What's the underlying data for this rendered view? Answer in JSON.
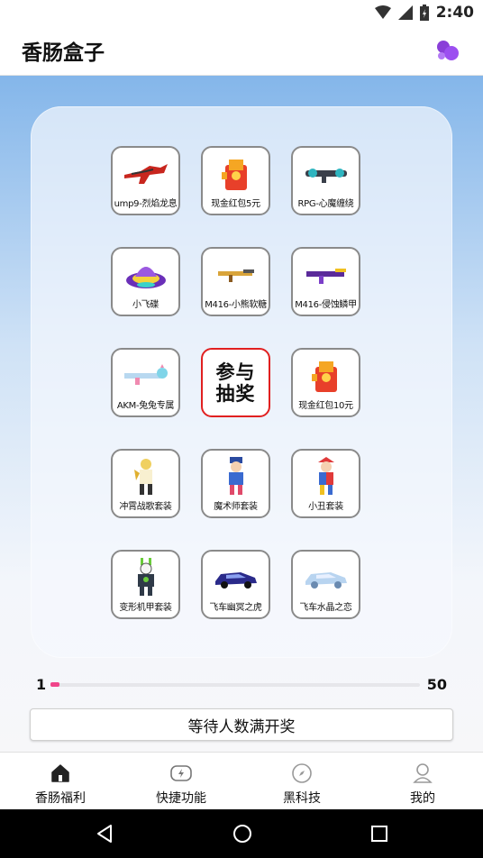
{
  "status": {
    "time": "2:40"
  },
  "app": {
    "title": "香肠盒子",
    "logo_icon": "purple-bubbles-icon"
  },
  "grid": {
    "items": [
      {
        "label": "ump9-烈焰龙息",
        "icon": "red-dragon-gun-icon"
      },
      {
        "label": "现金红包5元",
        "icon": "red-envelope-icon"
      },
      {
        "label": "RPG-心魔缠绕",
        "icon": "rpg-launcher-icon"
      },
      {
        "label": "小飞碟",
        "icon": "ufo-icon"
      },
      {
        "label": "M416-小熊软糖",
        "icon": "gold-rifle-icon"
      },
      {
        "label": "M416-侵蚀鳞甲",
        "icon": "purple-rifle-icon"
      },
      {
        "label": "AKM-兔兔专属",
        "icon": "bunny-rifle-icon"
      },
      {
        "label": "现金红包10元",
        "icon": "red-envelope-icon"
      },
      {
        "label": "冲霄战歌套装",
        "icon": "armor-suit-icon"
      },
      {
        "label": "魔术师套装",
        "icon": "magician-suit-icon"
      },
      {
        "label": "小丑套装",
        "icon": "clown-suit-icon"
      },
      {
        "label": "变形机甲套装",
        "icon": "mech-suit-icon"
      },
      {
        "label": "飞车幽冥之虎",
        "icon": "purple-car-icon"
      },
      {
        "label": "飞车水晶之恋",
        "icon": "crystal-car-icon"
      }
    ],
    "center_line1": "参与",
    "center_line2": "抽奖"
  },
  "progress": {
    "min": "1",
    "max": "50",
    "fraction": 0.02,
    "fill_color": "#f0458a"
  },
  "action": {
    "button_label": "等待人数满开奖"
  },
  "nav": {
    "items": [
      {
        "label": "香肠福利",
        "icon": "home-icon"
      },
      {
        "label": "快捷功能",
        "icon": "gamepad-icon"
      },
      {
        "label": "黑科技",
        "icon": "compass-icon"
      },
      {
        "label": "我的",
        "icon": "profile-icon"
      }
    ]
  }
}
